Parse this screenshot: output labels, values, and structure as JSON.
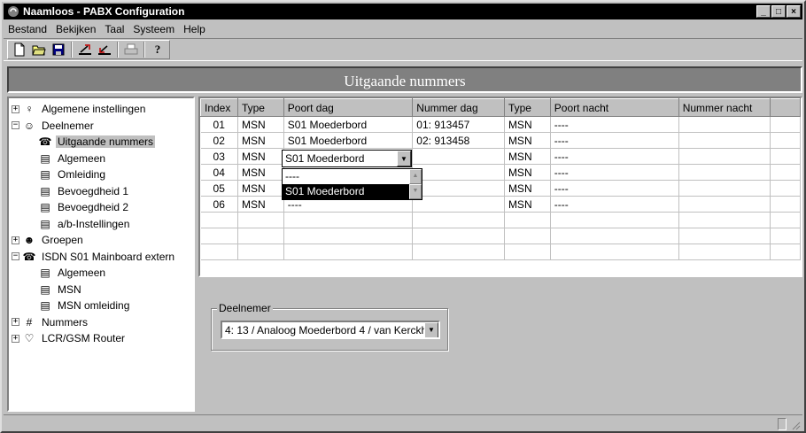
{
  "window": {
    "title": "Naamloos - PABX Configuration",
    "buttons": [
      "_",
      "□",
      "×"
    ]
  },
  "menu": [
    {
      "label": "Bestand"
    },
    {
      "label": "Bekijken"
    },
    {
      "label": "Taal"
    },
    {
      "label": "Systeem"
    },
    {
      "label": "Help"
    }
  ],
  "toolbar": {
    "icons": [
      "new-file-icon",
      "open-folder-icon",
      "save-disk-icon",
      "upload-icon",
      "download-icon",
      "print-icon",
      "help-icon"
    ]
  },
  "heading": "Uitgaande nummers",
  "tree": [
    {
      "label": "Algemene instellingen",
      "expander": "+",
      "icon": "settings-person-icon",
      "level": 0
    },
    {
      "label": "Deelnemer",
      "expander": "−",
      "icon": "users-icon",
      "level": 0
    },
    {
      "label": "Uitgaande nummers",
      "icon": "phone-icon",
      "level": 1,
      "selected": true
    },
    {
      "label": "Algemeen",
      "icon": "form-icon",
      "level": 1
    },
    {
      "label": "Omleiding",
      "icon": "form-icon",
      "level": 1
    },
    {
      "label": "Bevoegdheid 1",
      "icon": "form-icon",
      "level": 1
    },
    {
      "label": "Bevoegdheid 2",
      "icon": "form-icon",
      "level": 1
    },
    {
      "label": "a/b-Instellingen",
      "icon": "form-icon",
      "level": 1
    },
    {
      "label": "Groepen",
      "expander": "+",
      "icon": "group-icon",
      "level": 0
    },
    {
      "label": "ISDN S01 Mainboard extern",
      "expander": "−",
      "icon": "phone-icon",
      "level": 0
    },
    {
      "label": "Algemeen",
      "icon": "form-icon",
      "level": 1
    },
    {
      "label": "MSN",
      "icon": "form-icon",
      "level": 1
    },
    {
      "label": "MSN omleiding",
      "icon": "form-icon",
      "level": 1
    },
    {
      "label": "Nummers",
      "expander": "+",
      "icon": "numbers-icon",
      "level": 0
    },
    {
      "label": "LCR/GSM Router",
      "expander": "+",
      "icon": "heart-icon",
      "level": 0
    }
  ],
  "grid": {
    "columns": [
      "Index",
      "Type",
      "Poort dag",
      "Nummer dag",
      "Type",
      "Poort nacht",
      "Nummer nacht",
      ""
    ],
    "rows": [
      [
        "01",
        "MSN",
        "S01 Moederbord",
        "01: 913457",
        "MSN",
        "----",
        "",
        ""
      ],
      [
        "02",
        "MSN",
        "S01 Moederbord",
        "02: 913458",
        "MSN",
        "----",
        "",
        ""
      ],
      [
        "03",
        "MSN",
        "",
        "",
        "MSN",
        "----",
        "",
        ""
      ],
      [
        "04",
        "MSN",
        "",
        "",
        "MSN",
        "----",
        "",
        ""
      ],
      [
        "05",
        "MSN",
        "",
        "",
        "MSN",
        "----",
        "",
        ""
      ],
      [
        "06",
        "MSN",
        "----",
        "",
        "MSN",
        "----",
        "",
        ""
      ],
      [
        "",
        "",
        "",
        "",
        "",
        "",
        "",
        ""
      ],
      [
        "",
        "",
        "",
        "",
        "",
        "",
        "",
        ""
      ],
      [
        "",
        "",
        "",
        "",
        "",
        "",
        "",
        ""
      ]
    ]
  },
  "combo": {
    "value": "S01 Moederbord",
    "options": [
      "----",
      "S01 Moederbord"
    ],
    "highlighted": "S01 Moederbord"
  },
  "deelnemer": {
    "label": "Deelnemer",
    "value": "4: 13 / Analoog Moederbord 4 / van Kerckh"
  }
}
